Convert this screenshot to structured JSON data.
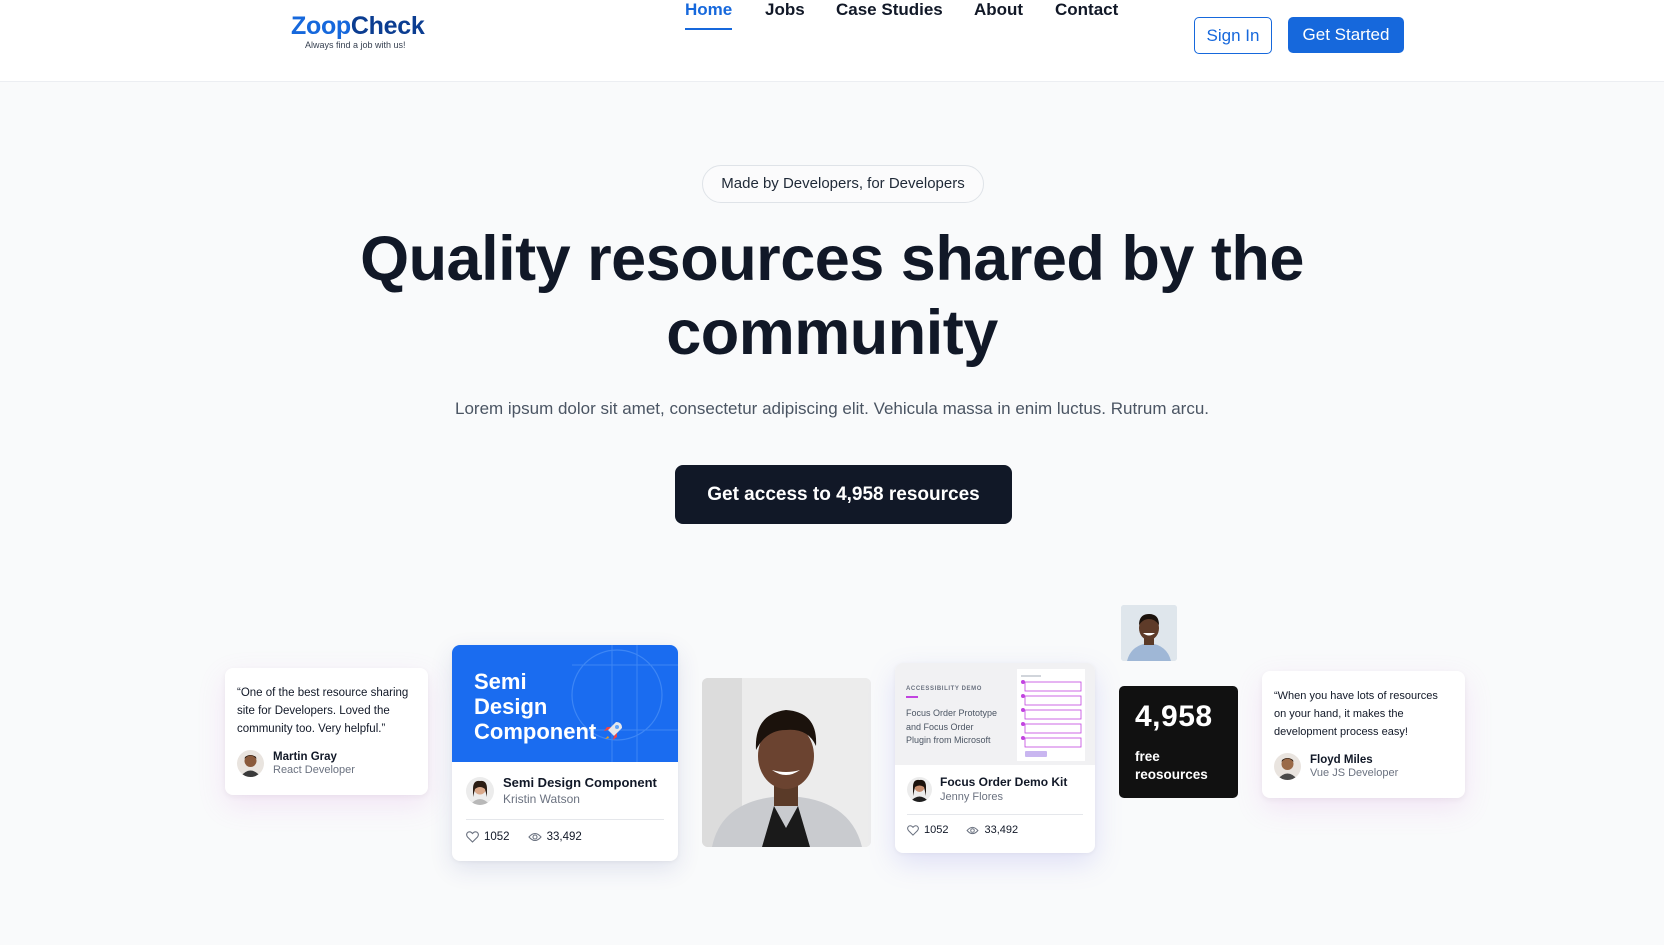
{
  "brand": {
    "name_part1": "Zoop",
    "name_part2": "Check",
    "tagline": "Always find a job with us!"
  },
  "nav": {
    "items": [
      {
        "label": "Home",
        "active": true
      },
      {
        "label": "Jobs",
        "active": false
      },
      {
        "label": "Case Studies",
        "active": false
      },
      {
        "label": "About",
        "active": false
      },
      {
        "label": "Contact",
        "active": false
      }
    ],
    "sign_in": "Sign In",
    "get_started": "Get Started"
  },
  "hero": {
    "badge": "Made by Developers, for Developers",
    "title_line1": "Quality resources shared by the",
    "title_line2": "community",
    "subtitle": "Lorem ipsum dolor sit amet, consectetur adipiscing elit. Vehicula massa in enim luctus. Rutrum arcu.",
    "cta": "Get access to 4,958 resources"
  },
  "testimonials": [
    {
      "quote": "“One of the best resource sharing site for Developers. Loved the community too. Very helpful.”",
      "name": "Martin Gray",
      "role": "React Developer"
    },
    {
      "quote": "“When you have lots of resources on your hand, it makes the development process easy!",
      "name": "Floyd Miles",
      "role": "Vue JS Developer"
    }
  ],
  "resources": [
    {
      "thumb_line1": "Semi",
      "thumb_line2": "Design",
      "thumb_line3": "Component",
      "title": "Semi Design Component",
      "author": "Kristin Watson",
      "likes": "1052",
      "views": "33,492"
    },
    {
      "thumb_kicker": "ACCESSIBILITY DEMO",
      "thumb_line1": "Focus Order Prototype",
      "thumb_line2": "and Focus Order",
      "thumb_line3": "Plugin from Microsoft",
      "title": "Focus Order Demo Kit",
      "author": "Jenny Flores",
      "likes": "1052",
      "views": "33,492"
    }
  ],
  "counter": {
    "number": "4,958",
    "label_line1": "free",
    "label_line2": "reosources"
  },
  "icons": {
    "like": "heart-icon",
    "views": "eye-icon",
    "rocket": "rocket-icon"
  },
  "colors": {
    "primary": "#1668dc",
    "dark": "#111827",
    "card_blue": "#1a6cf0",
    "focus_accent": "#c244e0"
  }
}
